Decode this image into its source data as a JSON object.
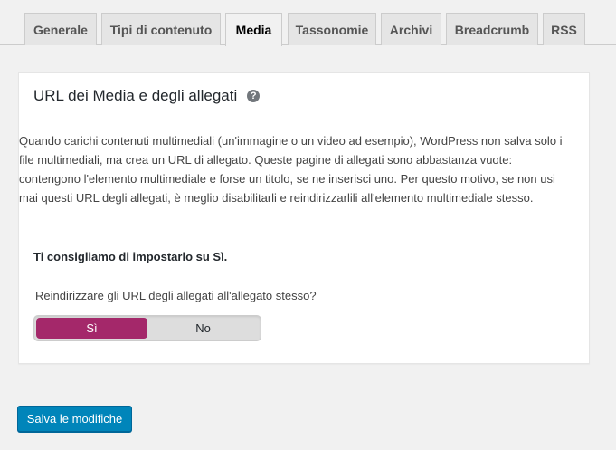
{
  "tabs": [
    {
      "label": "Generale",
      "active": false
    },
    {
      "label": "Tipi di contenuto",
      "active": false
    },
    {
      "label": "Media",
      "active": true
    },
    {
      "label": "Tassonomie",
      "active": false
    },
    {
      "label": "Archivi",
      "active": false
    },
    {
      "label": "Breadcrumb",
      "active": false
    },
    {
      "label": "RSS",
      "active": false
    }
  ],
  "card": {
    "title": "URL dei Media e degli allegati",
    "help_icon": "question-circle-icon",
    "description_lines": [
      "Quando carichi contenuti multimediali (un'immagine o un video ad esempio), WordPress non salva solo i",
      "file multimediali, ma crea un URL di allegato. Queste pagine di allegati sono abbastanza vuote:",
      "contengono l'elemento multimediale e forse un titolo, se ne inserisci uno. Per questo motivo, se non usi",
      "mai questi URL degli allegati, è meglio disabilitarli e reindirizzarlili all'elemento multimediale stesso."
    ],
    "recommendation": "Ti consigliamo di impostarlo su Sì.",
    "question": "Reindirizzare gli URL degli allegati all'allegato stesso?",
    "toggle": {
      "yes_label": "Sì",
      "no_label": "No",
      "selected": "Sì"
    }
  },
  "footer": {
    "save_label": "Salva le modifiche"
  },
  "colors": {
    "accent": "#a4286a",
    "button": "#0085ba",
    "background": "#f1f1f1"
  }
}
